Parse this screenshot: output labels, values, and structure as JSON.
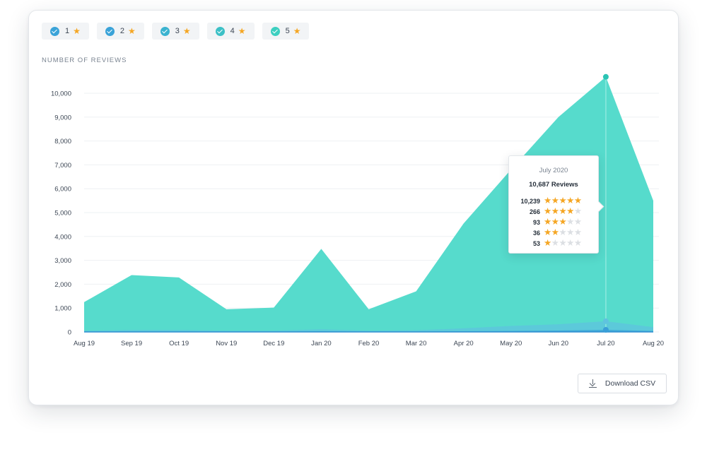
{
  "filters": [
    {
      "label": "1",
      "checked": true,
      "color": "#3aa3d8"
    },
    {
      "label": "2",
      "checked": true,
      "color": "#3aa3d8"
    },
    {
      "label": "3",
      "checked": true,
      "color": "#3ab3d0"
    },
    {
      "label": "4",
      "checked": true,
      "color": "#3cc0c6"
    },
    {
      "label": "5",
      "checked": true,
      "color": "#3ccfc0"
    }
  ],
  "star_icon": "star-icon",
  "download": {
    "label": "Download CSV",
    "icon": "download-icon"
  },
  "tooltip": {
    "title": "July 2020",
    "total": "10,687 Reviews",
    "rows": [
      {
        "count": "10,239",
        "stars": 5
      },
      {
        "count": "266",
        "stars": 4
      },
      {
        "count": "93",
        "stars": 3
      },
      {
        "count": "36",
        "stars": 2
      },
      {
        "count": "53",
        "stars": 1
      }
    ]
  },
  "chart_data": {
    "type": "area",
    "title": "NUMBER OF REVIEWS",
    "xlabel": "",
    "ylabel": "",
    "categories": [
      "Aug 19",
      "Sep 19",
      "Oct 19",
      "Nov 19",
      "Dec 19",
      "Jan 20",
      "Feb 20",
      "Mar 20",
      "Apr 20",
      "May 20",
      "Jun 20",
      "Jul 20",
      "Aug 20"
    ],
    "ylim": [
      0,
      10000
    ],
    "yticks": [
      0,
      1000,
      2000,
      3000,
      4000,
      5000,
      6000,
      7000,
      8000,
      9000,
      10000
    ],
    "ytick_labels": [
      "0",
      "1,000",
      "2,000",
      "3,000",
      "4,000",
      "5,000",
      "6,000",
      "7,000",
      "8,000",
      "9,000",
      "10,000"
    ],
    "grid": true,
    "series": [
      {
        "name": "5",
        "color": "#4dd9c9",
        "values": [
          1250,
          2380,
          2280,
          950,
          1020,
          3480,
          950,
          1700,
          4540,
          6800,
          9000,
          10687,
          5500
        ]
      },
      {
        "name": "4",
        "color": "#5fc3df",
        "values": [
          50,
          80,
          80,
          50,
          50,
          110,
          50,
          70,
          150,
          250,
          320,
          448,
          200
        ]
      },
      {
        "name": "1",
        "color": "#3a9fd8",
        "values": [
          10,
          20,
          20,
          10,
          10,
          30,
          10,
          15,
          30,
          40,
          60,
          89,
          40
        ]
      }
    ],
    "highlight_index": 11
  }
}
